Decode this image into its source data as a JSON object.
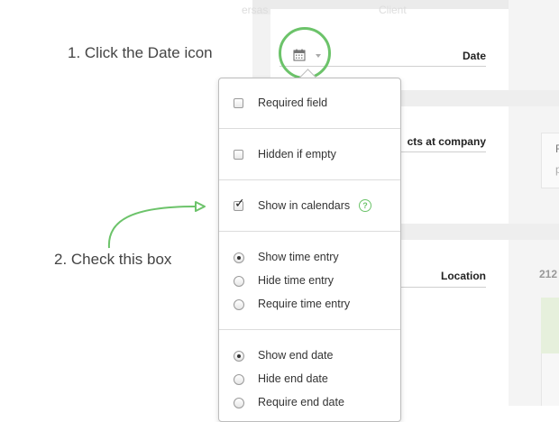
{
  "background": {
    "faded_header_left": "ersas",
    "faded_header_mid": "Client",
    "field_date": "Date",
    "field_contacts": "cts at company",
    "field_location": "Location",
    "side_letter_f": "F",
    "side_letter_p": "p",
    "side_number": "212"
  },
  "instructions": {
    "step1": "1. Click the Date icon",
    "step2": "2. Check this box"
  },
  "icons": {
    "date_icon": "calendar-icon",
    "caret": "caret-down-icon",
    "help": "help-icon",
    "accent_color": "#6cc36a"
  },
  "popup": {
    "required_field": {
      "label": "Required field",
      "checked": false
    },
    "hidden_if_empty": {
      "label": "Hidden if empty",
      "checked": false
    },
    "show_in_calendars": {
      "label": "Show in calendars",
      "checked": true,
      "help_glyph": "?"
    },
    "time_entry": [
      {
        "label": "Show time entry",
        "selected": true
      },
      {
        "label": "Hide time entry",
        "selected": false
      },
      {
        "label": "Require time entry",
        "selected": false
      }
    ],
    "end_date": [
      {
        "label": "Show end date",
        "selected": true
      },
      {
        "label": "Hide end date",
        "selected": false
      },
      {
        "label": "Require end date",
        "selected": false
      }
    ]
  }
}
